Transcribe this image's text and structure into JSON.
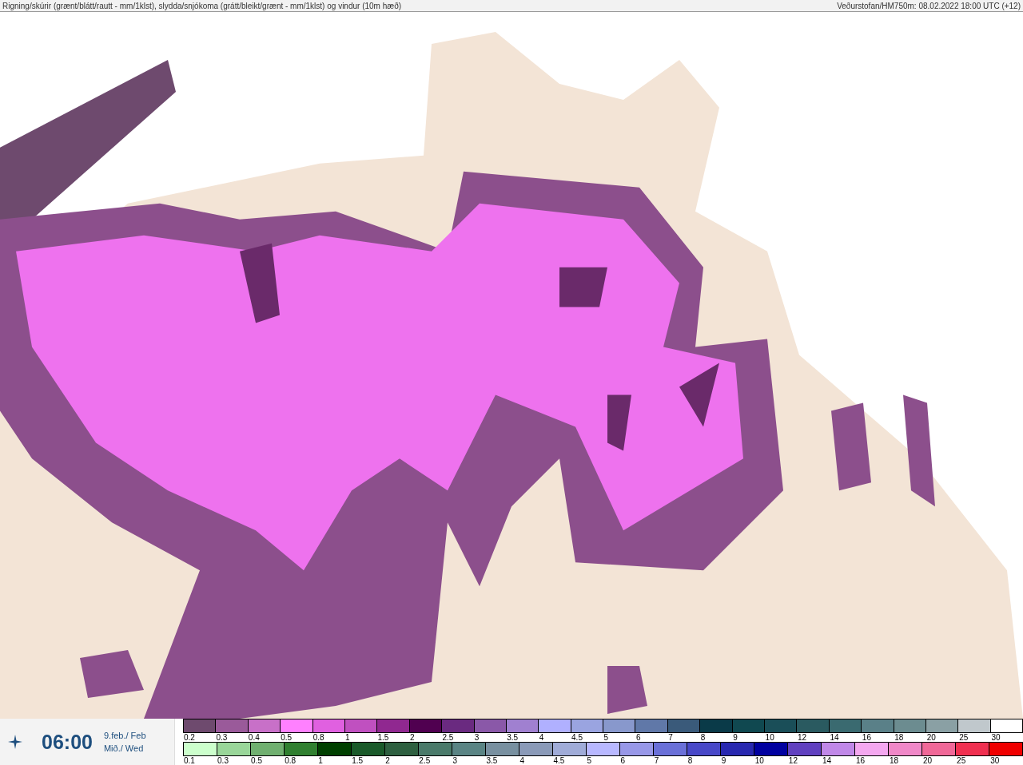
{
  "header": {
    "title": "Rigning/skúrir (grænt/blátt/rautt - mm/1klst), slydda/snjókoma (grátt/bleikt/grænt - mm/1klst) og vindur (10m hæð)",
    "source": "Veðurstofan/HM750m: 08.02.2022 18:00 UTC (+12)"
  },
  "time_panel": {
    "time": "06:00",
    "date": "9.feb./ Feb",
    "weekday": "Mið./ Wed"
  },
  "legends": [
    {
      "kind": "snow",
      "items": [
        {
          "label": "0.2",
          "color": "#6e4a6e"
        },
        {
          "label": "0.3",
          "color": "#9a5a9a"
        },
        {
          "label": "0.4",
          "color": "#c870c8"
        },
        {
          "label": "0.5",
          "color": "#ff80ff"
        },
        {
          "label": "0.8",
          "color": "#e060e0"
        },
        {
          "label": "1",
          "color": "#c050c0"
        },
        {
          "label": "1.5",
          "color": "#902890"
        },
        {
          "label": "2",
          "color": "#500050"
        },
        {
          "label": "2.5",
          "color": "#6a2a80"
        },
        {
          "label": "3",
          "color": "#8a58a8"
        },
        {
          "label": "3.5",
          "color": "#a080d0"
        },
        {
          "label": "4",
          "color": "#b0b0ff"
        },
        {
          "label": "4.5",
          "color": "#9aa4e0"
        },
        {
          "label": "5",
          "color": "#8898cc"
        },
        {
          "label": "6",
          "color": "#6078a8"
        },
        {
          "label": "7",
          "color": "#3a5a7a"
        },
        {
          "label": "8",
          "color": "#0a3a48"
        },
        {
          "label": "9",
          "color": "#104850"
        },
        {
          "label": "10",
          "color": "#1a4e58"
        },
        {
          "label": "12",
          "color": "#2a5a60"
        },
        {
          "label": "14",
          "color": "#3a6a70"
        },
        {
          "label": "16",
          "color": "#5a8088"
        },
        {
          "label": "18",
          "color": "#6c8c90"
        },
        {
          "label": "20",
          "color": "#8aa0a4"
        },
        {
          "label": "25",
          "color": "#c0c8cc"
        },
        {
          "label": "30",
          "color": "#ffffff"
        }
      ]
    },
    {
      "kind": "rain",
      "items": [
        {
          "label": "0.1",
          "color": "#ccffcc"
        },
        {
          "label": "0.3",
          "color": "#99d699"
        },
        {
          "label": "0.5",
          "color": "#70b070"
        },
        {
          "label": "0.8",
          "color": "#308030"
        },
        {
          "label": "1",
          "color": "#004000"
        },
        {
          "label": "1.5",
          "color": "#1a5a2a"
        },
        {
          "label": "2",
          "color": "#2e6040"
        },
        {
          "label": "2.5",
          "color": "#4a7a6a"
        },
        {
          "label": "3",
          "color": "#5a8484"
        },
        {
          "label": "3.5",
          "color": "#7890a0"
        },
        {
          "label": "4",
          "color": "#8a9ab8"
        },
        {
          "label": "4.5",
          "color": "#a0acd8"
        },
        {
          "label": "5",
          "color": "#b8b8ff"
        },
        {
          "label": "6",
          "color": "#9898e8"
        },
        {
          "label": "7",
          "color": "#6a70d8"
        },
        {
          "label": "8",
          "color": "#4848c8"
        },
        {
          "label": "9",
          "color": "#2828b0"
        },
        {
          "label": "10",
          "color": "#0000a0"
        },
        {
          "label": "12",
          "color": "#6040c0"
        },
        {
          "label": "14",
          "color": "#c088e8"
        },
        {
          "label": "16",
          "color": "#f4a8f0"
        },
        {
          "label": "18",
          "color": "#f088c8"
        },
        {
          "label": "20",
          "color": "#f06898"
        },
        {
          "label": "25",
          "color": "#f03050"
        },
        {
          "label": "30",
          "color": "#f00000"
        }
      ]
    }
  ]
}
